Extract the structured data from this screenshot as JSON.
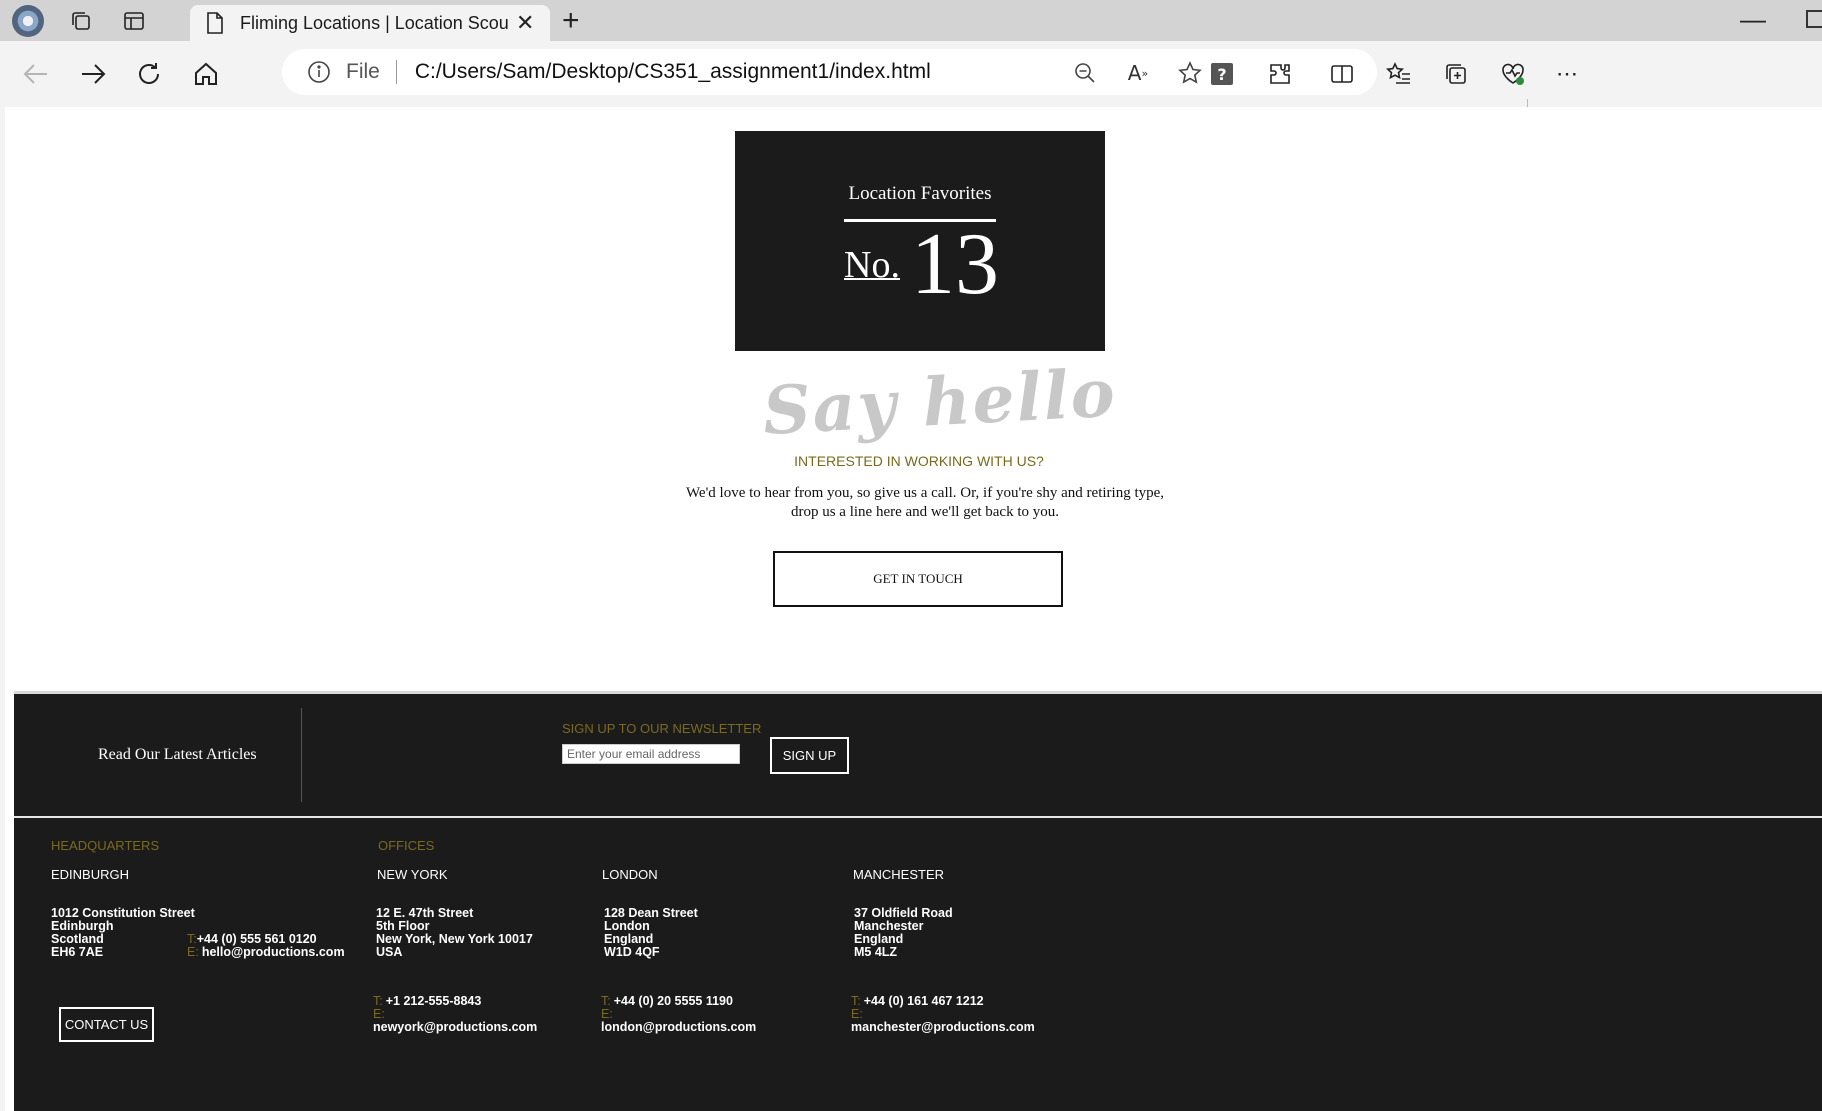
{
  "browser": {
    "tab_title": "Fliming Locations | Location Scou",
    "address_scheme": "File",
    "url": "C:/Users/Sam/Desktop/CS351_assignment1/index.html"
  },
  "favorites": {
    "title": "Location Favorites",
    "no_label": "No.",
    "number": "13"
  },
  "hello": {
    "heading": "Say hello",
    "subheading": "INTERESTED IN WORKING WITH US?",
    "body": "We'd love to hear from you, so give us a call. Or, if you're shy and retiring type, drop us a line here and we'll get back to you.",
    "button": "GET IN TOUCH"
  },
  "footer": {
    "articles_link": "Read Our Latest Articles",
    "newsletter_label": "SIGN UP TO OUR NEWSLETTER",
    "email_placeholder": "Enter your email address",
    "signup_button": "SIGN UP",
    "headquarters_label": "HEADQUARTERS",
    "offices_label": "OFFICES",
    "contact_button": "CONTACT US",
    "phone_key": "T:",
    "email_key": "E:",
    "hq": {
      "city": "EDINBURGH",
      "address": [
        "1012 Constitution Street",
        "Edinburgh",
        "Scotland",
        "EH6 7AE"
      ],
      "phone": "+44 (0) 555 561 0120",
      "email": "hello@productions.com"
    },
    "offices": [
      {
        "city": "NEW YORK",
        "address": [
          "12 E. 47th Street",
          "5th Floor",
          "New York, New York 10017",
          "USA"
        ],
        "phone": "+1 212-555-8843",
        "email": "newyork@productions.com"
      },
      {
        "city": "LONDON",
        "address": [
          "128 Dean Street",
          "London",
          "England",
          "W1D 4QF"
        ],
        "phone": "+44 (0) 20 5555 1190",
        "email": "london@productions.com"
      },
      {
        "city": "MANCHESTER",
        "address": [
          "37 Oldfield Road",
          "Manchester",
          "England",
          "M5 4LZ"
        ],
        "phone": "+44 (0) 161 467 1212",
        "email": "manchester@productions.com"
      }
    ]
  },
  "colors": {
    "accent": "#7a6a1e",
    "dark": "#1b1b1b"
  }
}
